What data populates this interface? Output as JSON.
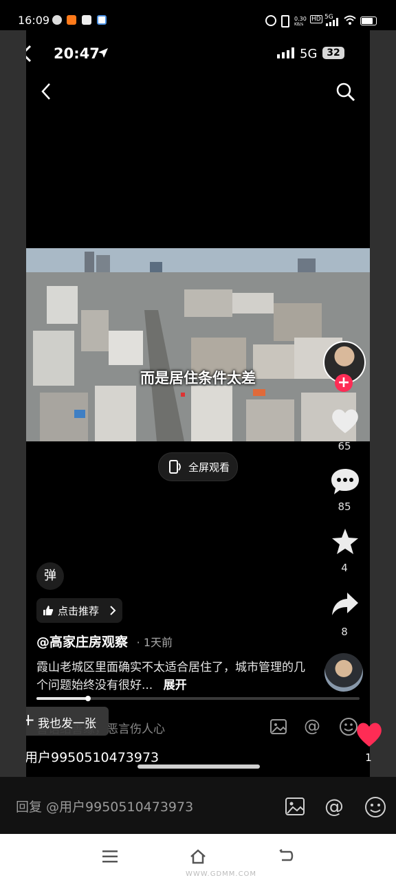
{
  "outer_status": {
    "time": "16:09",
    "speed": "0.30",
    "speed_unit": "KB/s",
    "hd": "HD",
    "network": "5G"
  },
  "inner_status": {
    "time": "20:47",
    "network": "5G",
    "battery": "32"
  },
  "video": {
    "subtitle": "而是居住条件太差",
    "fullscreen_label": "全屏观看"
  },
  "actions": {
    "likes": "65",
    "comments": "85",
    "favorites": "4",
    "shares": "8"
  },
  "danmaku_label": "弹",
  "recommend_label": "点击推荐",
  "post": {
    "author": "@高家庄房观察",
    "time_ago": "· 1天前",
    "description": "霞山老城区里面确实不太适合居住了，城市管理的几个问题始终没有很好...",
    "expand_label": "展开",
    "progress": 0.16
  },
  "comment_placeholder": "善语结善缘，恶言伤人心",
  "send_one_label": "我也发一张",
  "reply_user": "@用户9950510473973",
  "float_like_count": "1",
  "reply_bar": {
    "placeholder": "回复 @用户9950510473973"
  },
  "watermark": "WWW.GDMM.COM",
  "icons": {
    "back": "back-arrow-icon",
    "search": "search-icon",
    "like": "heart-icon",
    "comment": "comment-icon",
    "favorite": "star-icon",
    "share": "share-icon",
    "image": "image-icon",
    "mention": "at-icon",
    "emoji": "emoji-icon",
    "thumb": "thumb-up-icon"
  },
  "colors": {
    "accent": "#fe2c55",
    "background": "#000000"
  }
}
